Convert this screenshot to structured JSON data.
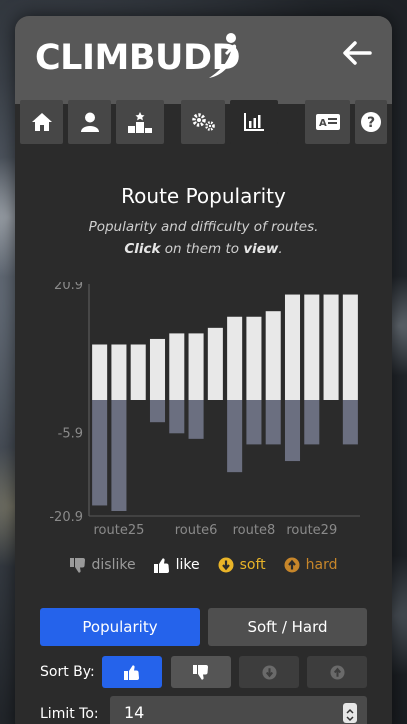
{
  "app": {
    "logo_text": "CLIMBUDD",
    "back_icon": "arrow-left-icon"
  },
  "tabs": [
    {
      "icon": "home-icon",
      "active": false
    },
    {
      "icon": "user-icon",
      "active": false
    },
    {
      "icon": "podium-icon",
      "active": false
    },
    {
      "icon": "gears-icon",
      "active": false
    },
    {
      "icon": "bar-chart-icon",
      "active": true
    },
    {
      "icon": "id-card-icon",
      "active": false
    },
    {
      "icon": "help-icon",
      "active": false
    }
  ],
  "page": {
    "title": "Route Popularity",
    "subtitle_line1": "Popularity and difficulty of routes.",
    "subtitle_click": "Click",
    "subtitle_mid": " on them to ",
    "subtitle_view": "view",
    "subtitle_end": "."
  },
  "chart_data": {
    "type": "bar",
    "categories": [
      "",
      "route25",
      "",
      "",
      "",
      "route6",
      "",
      "",
      "route8",
      "",
      "",
      "route29",
      "",
      ""
    ],
    "x_tick_labels": [
      "route25",
      "route6",
      "route8",
      "route29"
    ],
    "series": [
      {
        "name": "like",
        "color": "#e8e8e8",
        "values": [
          10,
          10,
          10,
          11,
          12,
          12,
          13,
          15,
          15,
          16,
          19,
          19,
          19,
          19
        ]
      },
      {
        "name": "dislike",
        "color": "#6b6f80",
        "values": [
          -19,
          -20,
          0,
          -4,
          -6,
          -7,
          0,
          -13,
          -8,
          -8,
          -11,
          -8,
          0,
          -8
        ]
      }
    ],
    "y_ticks": [
      20.9,
      -5.9,
      -20.9
    ],
    "y_tick_labels": [
      "20.9",
      "-5.9",
      "-20.9"
    ],
    "ylim": [
      -20.9,
      20.9
    ]
  },
  "legend": [
    {
      "label": "dislike",
      "icon": "thumbs-down-icon",
      "color": "#9a9a9a"
    },
    {
      "label": "like",
      "icon": "thumbs-up-icon",
      "color": "#ffffff"
    },
    {
      "label": "soft",
      "icon": "arrow-down-circle-icon",
      "color": "#e9b428"
    },
    {
      "label": "hard",
      "icon": "arrow-up-circle-icon",
      "color": "#c7862a"
    }
  ],
  "mode_buttons": {
    "popularity": "Popularity",
    "soft_hard": "Soft / Hard"
  },
  "sort": {
    "label": "Sort By:"
  },
  "limit": {
    "label": "Limit To:",
    "value": "14"
  },
  "colors": {
    "accent": "#2563eb",
    "panel": "#2b2b2b",
    "header": "#585858"
  }
}
